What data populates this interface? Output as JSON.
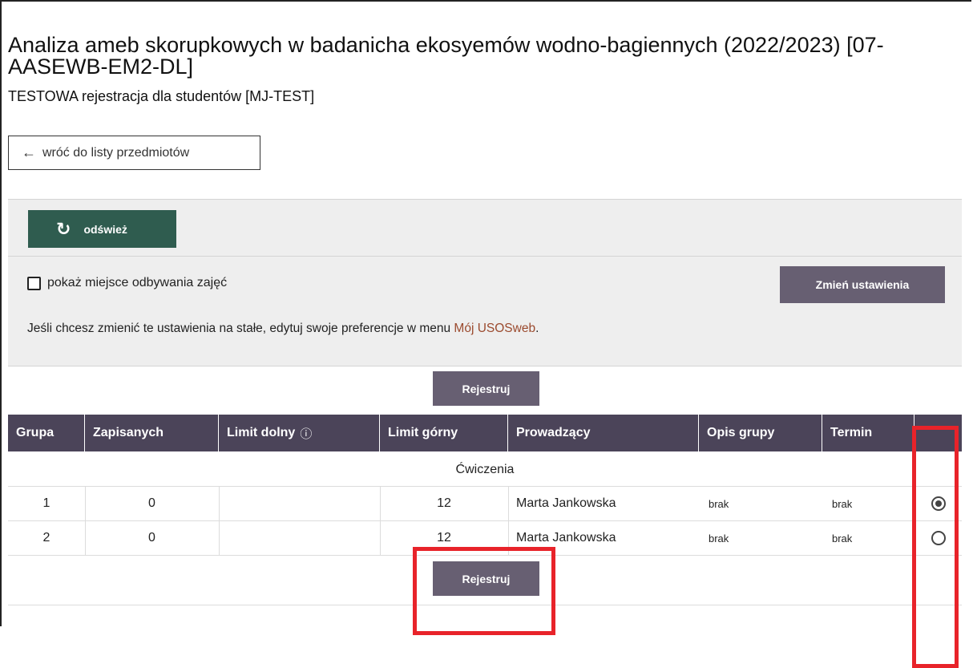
{
  "course": {
    "title": "Analiza ameb skorupkowych w badanicha ekosyemów wodno-bagiennych (2022/2023) [07-AASEWB-EM2-DL]",
    "registration": "TESTOWA rejestracja dla studentów [MJ-TEST]"
  },
  "back_button": {
    "arrow": "←",
    "label": "wróć do listy przedmiotów"
  },
  "toolbar": {
    "refresh_label": "odśwież",
    "show_location_label": "pokaż miejsce odbywania zajęć",
    "show_location_checked": false,
    "change_settings_label": "Zmień ustawienia",
    "info_text_before": "Jeśli chcesz zmienić te ustawienia na stałe, edytuj swoje preferencje w menu ",
    "info_link": "Mój USOSweb",
    "info_text_after": "."
  },
  "register_label": "Rejestruj",
  "table": {
    "headers": [
      "Grupa",
      "Zapisanych",
      "Limit dolny",
      "Limit górny",
      "Prowadzący",
      "Opis grupy",
      "Termin",
      ""
    ],
    "info_icon": "ⓘ",
    "section": "Ćwiczenia",
    "rows": [
      {
        "grupa": "1",
        "zapisanych": "0",
        "limit_dolny": "",
        "limit_gorny": "12",
        "prowadzacy": "Marta Jankowska",
        "opis": "brak",
        "termin": "brak",
        "selected": true
      },
      {
        "grupa": "2",
        "zapisanych": "0",
        "limit_dolny": "",
        "limit_gorny": "12",
        "prowadzacy": "Marta Jankowska",
        "opis": "brak",
        "termin": "brak",
        "selected": false
      }
    ]
  },
  "colors": {
    "header_bg": "#4b4459",
    "button_bg": "#675f72",
    "refresh_bg": "#2f5c4f",
    "link": "#9b4a2e",
    "highlight": "#e8232a"
  }
}
